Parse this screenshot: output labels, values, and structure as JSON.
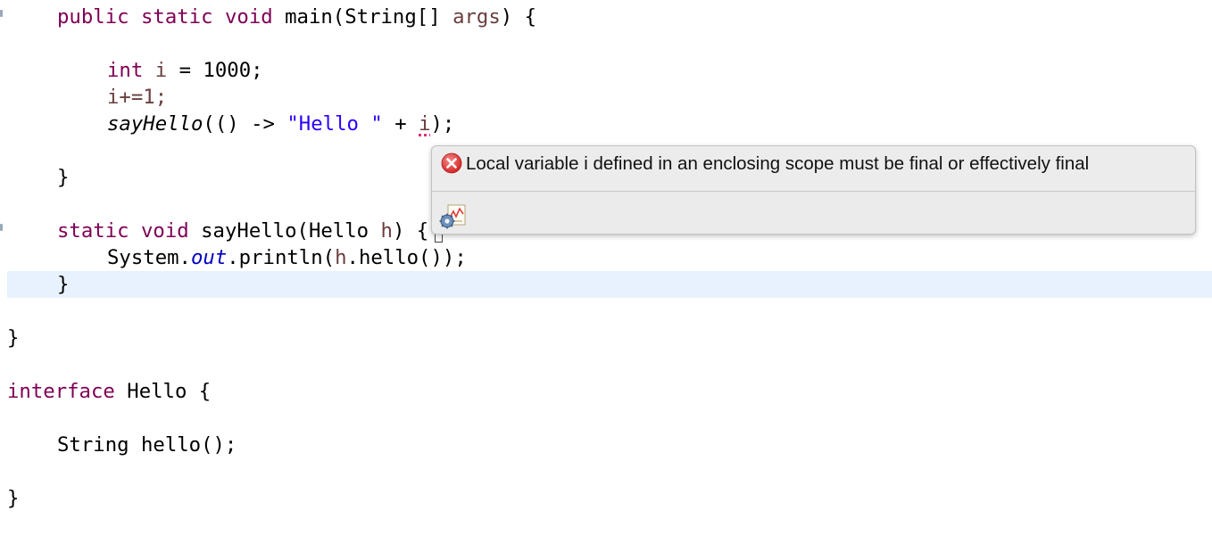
{
  "code": {
    "line1": {
      "kw_public": "public",
      "kw_static": "static",
      "kw_void": "void",
      "method": "main(String[]",
      "param": "args",
      "brace": ") {"
    },
    "line2": {
      "kw_int": "int",
      "var": "i",
      "rest": " = 1000;"
    },
    "line3": {
      "text": "i+=1;"
    },
    "line4": {
      "call": "sayHello",
      "args_open": "(() -> ",
      "str": "\"Hello \"",
      "plus": " + ",
      "err_var": "i",
      "end": ");"
    },
    "line5": {
      "brace": "}"
    },
    "line6": {
      "kw_static": "static",
      "kw_void": "void",
      "sig": "sayHello(Hello",
      "param": "h",
      "brace": ") {"
    },
    "line7": {
      "prefix": "System.",
      "field": "out",
      "call": ".println(",
      "param": "h",
      "suffix": ".hello());"
    },
    "line8": {
      "brace": "}"
    },
    "line9": {
      "brace": "}"
    },
    "line10": {
      "kw_interface": "interface",
      "name": "Hello {"
    },
    "line11": {
      "text": "String hello();"
    },
    "line12": {
      "brace": "}"
    }
  },
  "hover": {
    "error_message": "Local variable i defined in an enclosing scope must be final or effectively final",
    "error_icon": "error-circle-x-icon",
    "quickfix_icon": "quick-fix-icon"
  },
  "colors": {
    "keyword": "#7f0055",
    "string": "#2a00ff",
    "field": "#0000c0",
    "parameter": "#6a3e3e",
    "current_line": "#e8f2fe",
    "error": "#e43b3b"
  }
}
